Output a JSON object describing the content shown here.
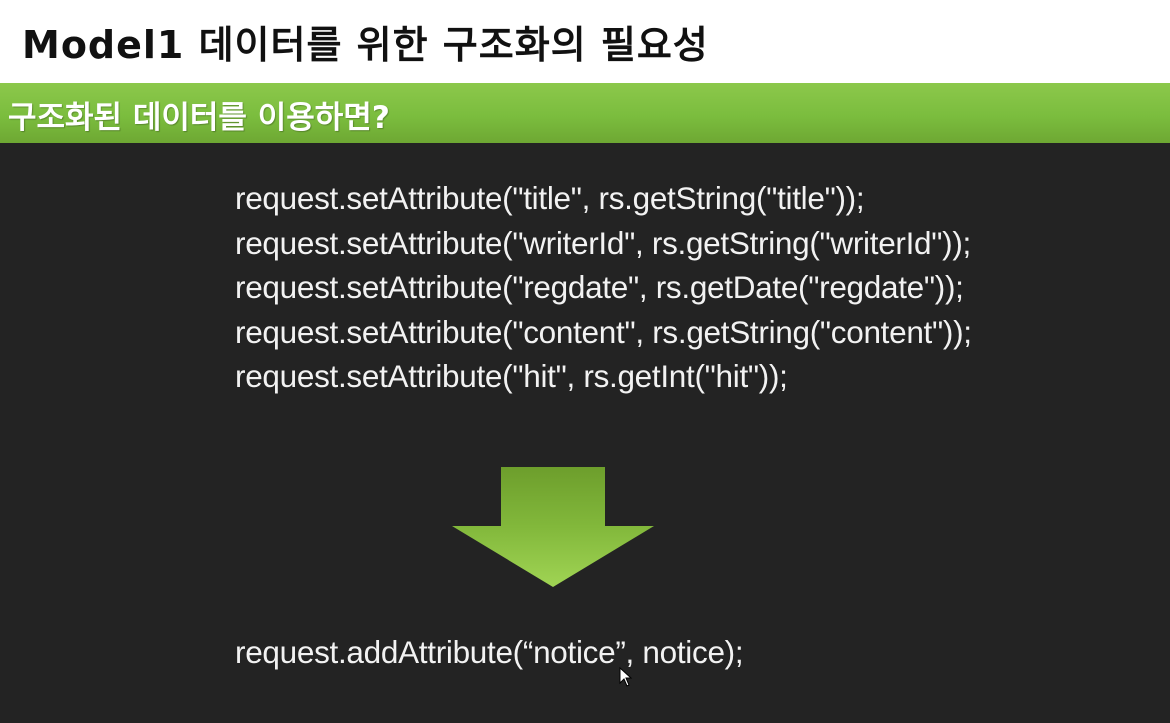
{
  "slide": {
    "title": "Model1 데이터를 위한 구조화의 필요성",
    "subtitle": "구조화된 데이터를 이용하면?",
    "code_lines": [
      "request.setAttribute(\"title\", rs.getString(\"title\"));",
      "request.setAttribute(\"writerId\", rs.getString(\"writerId\"));",
      "request.setAttribute(\"regdate\", rs.getDate(\"regdate\"));",
      "request.setAttribute(\"content\", rs.getString(\"content\"));",
      "request.setAttribute(\"hit\", rs.getInt(\"hit\"));"
    ],
    "result_line": "request.addAttribute(“notice”, notice);",
    "arrow_icon": "down-arrow-icon",
    "cursor_icon": "mouse-pointer-icon"
  },
  "colors": {
    "background": "#232323",
    "title_bar": "#ffffff",
    "subtitle_bar": "#7bbd3e",
    "arrow_top": "#7cae34",
    "arrow_bottom": "#9ad04f",
    "code_text": "#f2f2f2"
  }
}
